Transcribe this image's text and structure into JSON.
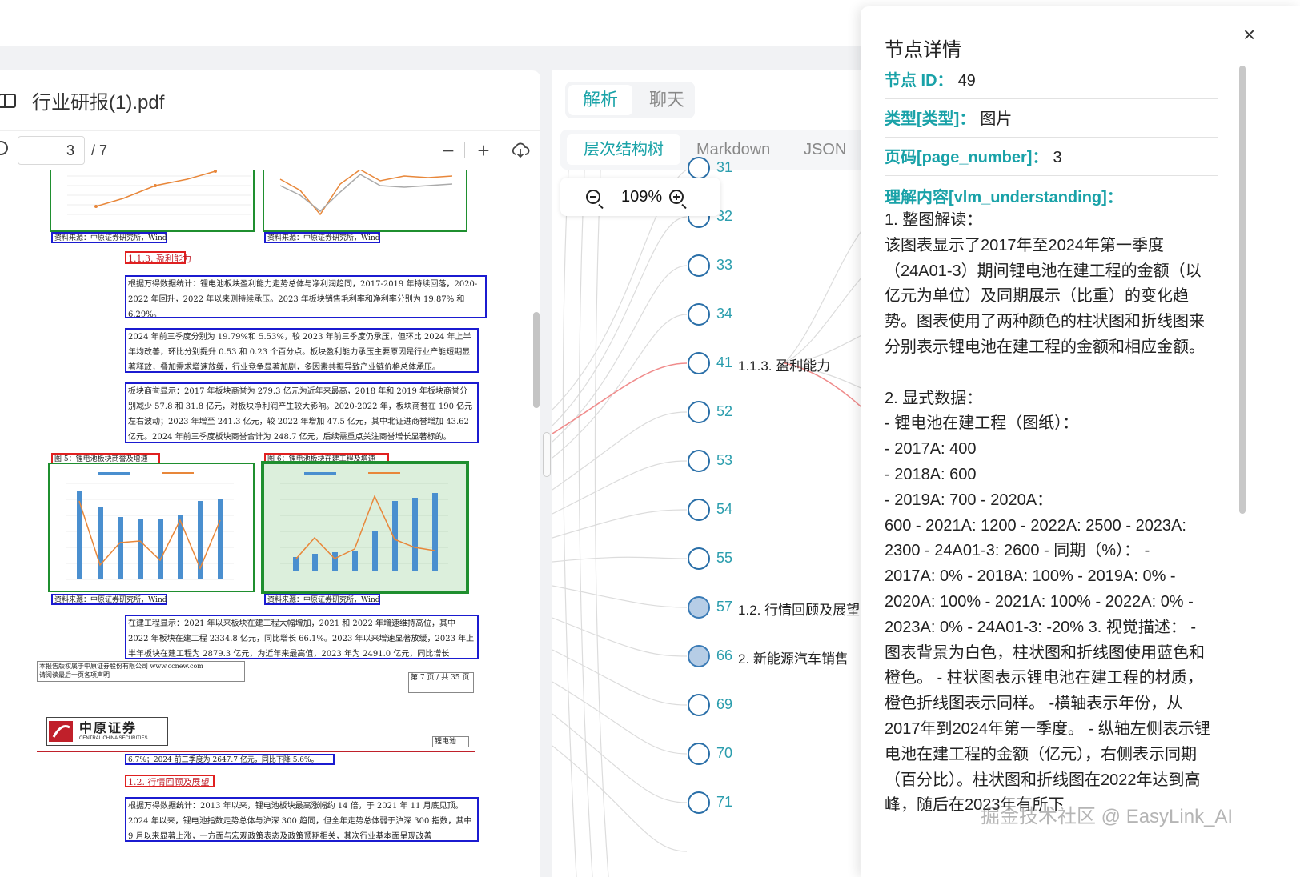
{
  "pdf": {
    "title": "行业研报(1).pdf",
    "page_value": "3",
    "page_total": "/ 7",
    "zoom_out": "−",
    "zoom_in": "+",
    "doc": {
      "src1": "资料来源：中原证券研究所，Wind",
      "src2": "资料来源：中原证券研究所，Wind",
      "sec113": "1.1.3. 盈利能力",
      "p1": "根据万得数据统计：锂电池板块盈利能力走势总体与净利润趋同，2017-2019 年持续回落，2020-2022 年回升，2022 年以来则持续承压。2023 年板块销售毛利率和净利率分别为 19.87% 和 6.29%。",
      "p2": "2024 年前三季度分别为 19.79%和 5.53%，较 2023 年前三季度仍承压，但环比 2024 年上半年均改善，环比分别提升 0.53 和 0.23 个百分点。板块盈利能力承压主要原因是行业产能短期显著释放，叠加需求增速放缓，行业竞争显著加剧，多因素共振导致产业链价格总体承压。",
      "p3": "板块商誉显示：2017 年板块商誉为 279.3 亿元为近年来最高，2018 年和 2019 年板块商誉分别减少 57.8 和 31.8 亿元，对板块净利润产生较大影响。2020-2022 年，板块商誉在 190 亿元左右波动；2023 年增至 241.3 亿元，较 2022 年增加 47.5 亿元，其中北证进商誉增加 43.62 亿元。2024 年前三季度板块商誉合计为 248.7 亿元，后续需重点关注商誉增长显著标的。",
      "fig5": "图 5：锂电池板块商誉及增速",
      "fig6": "图 6：锂电池板块在建工程及增速",
      "src3": "资料来源：中原证券研究所，Wind",
      "src4": "资料来源：中原证券研究所，Wind",
      "p4": "在建工程显示：2021 年以来板块在建工程大幅增加，2021 和 2022 年增速维持高位，其中 2022 年板块在建工程 2334.8 亿元，同比增长 66.1%。2023 年以来增速显著放缓，2023 年上半年板块在建工程为 2879.3 亿元，为近年来最高值，2023 年为 2491.0 亿元，同比增长",
      "footer1": "本报告版权属于中原证券股份有限公司    www.ccnew.com",
      "footer2": "请阅读最后一页各项声明",
      "pagefoot": "第 7 页 / 共 35 页",
      "logo_cn": "中原证券",
      "logo_en": "CENTRAL CHINA SECURITIES",
      "tag": "锂电池",
      "p5": "6.7%；2024 前三季度为 2647.7 亿元，同比下降 5.6%。",
      "sec12": "1.2. 行情回顾及展望",
      "p6": "根据万得数据统计：2013 年以来，锂电池板块最高涨幅约 14 倍，于 2021 年 11 月底见顶。2024 年以来，锂电池指数走势总体与沪深 300 趋同，但全年走势总体弱于沪深 300 指数，其中 9 月以来显著上涨，一方面与宏观政策表态及政策预期相关，其次行业基本面呈现改善"
    }
  },
  "mid": {
    "tab_parse": "解析",
    "tab_chat": "聊天",
    "sub_tree": "层次结构树",
    "sub_md": "Markdown",
    "sub_json": "JSON",
    "zoom": "109%",
    "nodes": [
      {
        "num": "31",
        "label": ""
      },
      {
        "num": "32",
        "label": ""
      },
      {
        "num": "33",
        "label": ""
      },
      {
        "num": "34",
        "label": ""
      },
      {
        "num": "41",
        "label": "1.1.3. 盈利能力"
      },
      {
        "num": "52",
        "label": ""
      },
      {
        "num": "53",
        "label": ""
      },
      {
        "num": "54",
        "label": ""
      },
      {
        "num": "55",
        "label": ""
      },
      {
        "num": "57",
        "label": "1.2. 行情回顾及展望"
      },
      {
        "num": "66",
        "label": "2. 新能源汽车销售"
      },
      {
        "num": "69",
        "label": ""
      },
      {
        "num": "70",
        "label": ""
      },
      {
        "num": "71",
        "label": ""
      }
    ]
  },
  "drawer": {
    "close": "×",
    "title": "节点详情",
    "id_key": "节点 ID：",
    "id_val": "49",
    "type_key": "类型[类型]：",
    "type_val": "图片",
    "page_key": "页码[page_number]：",
    "page_val": "3",
    "vlm_key": "理解内容[vlm_understanding]：",
    "vlm_text": "1. 整图解读：\n该图表显示了2017年至2024年第一季度（24A01-3）期间锂电池在建工程的金额（以亿元为单位）及同期展示（比重）的变化趋势。图表使用了两种颜色的柱状图和折线图来分别表示锂电池在建工程的金额和相应金额。\n\n2. 显式数据：\n- 锂电池在建工程（图纸）：\n- 2017A: 400\n- 2018A: 600\n- 2019A: 700 - 2020A：\n600 - 2021A: 1200 - 2022A: 2500 - 2023A:\n2300 - 24A01-3: 2600 - 同期（%）： -\n2017A: 0% - 2018A: 100% - 2019A: 0% -\n2020A: 100% - 2021A: 100% - 2022A: 0% -\n2023A: 0% - 24A01-3: -20% 3. 视觉描述： -\n图表背景为白色，柱状图和折线图使用蓝色和橙色。 - 柱状图表示锂电池在建工程的材质，橙色折线图表示同样。 -横轴表示年份，从2017年到2024年第一季度。 - 纵轴左侧表示锂电池在建工程的金额（亿元），右侧表示同期（百分比）。柱状图和折线图在2022年达到高峰，随后在2023年有所下",
    "watermark": "掘金技术社区 @ EasyLink_AI"
  }
}
